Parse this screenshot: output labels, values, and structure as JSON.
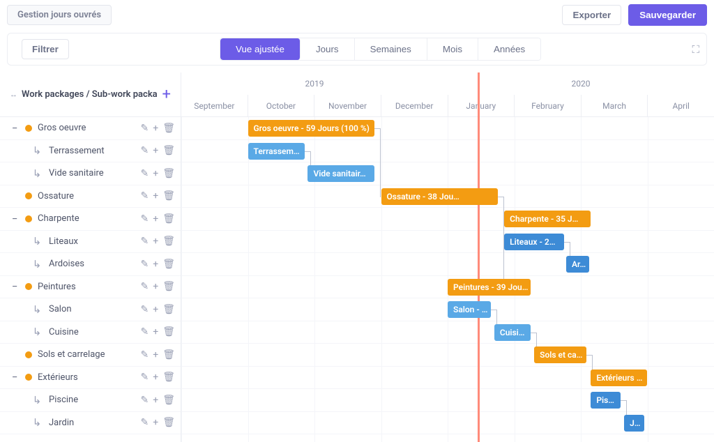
{
  "header": {
    "title": "Gestion jours ouvrés",
    "export_label": "Exporter",
    "save_label": "Sauvegarder"
  },
  "toolbar": {
    "filter_label": "Filtrer",
    "views": {
      "adjusted": "Vue ajustée",
      "days": "Jours",
      "weeks": "Semaines",
      "months": "Mois",
      "years": "Années"
    }
  },
  "sidebar": {
    "header": "Work packages / Sub-work packa"
  },
  "timeline": {
    "years": [
      "2019",
      "2020"
    ],
    "months": [
      "September",
      "October",
      "November",
      "December",
      "January",
      "February",
      "March",
      "April"
    ]
  },
  "tasks": [
    {
      "id": "gros",
      "level": 0,
      "label": "Gros oeuvre",
      "bar": "Gros oeuvre - 59 Jours (100 %)",
      "color": "orange"
    },
    {
      "id": "terr",
      "level": 1,
      "label": "Terrassement",
      "bar": "Terrassem…",
      "color": "blue"
    },
    {
      "id": "vide",
      "level": 1,
      "label": "Vide sanitaire",
      "bar": "Vide sanitair…",
      "color": "blue"
    },
    {
      "id": "ossa",
      "level": 0,
      "label": "Ossature",
      "bar": "Ossature - 38 Jou…",
      "color": "orange",
      "notoggle": true
    },
    {
      "id": "charp",
      "level": 0,
      "label": "Charpente",
      "bar": "Charpente - 35 J…",
      "color": "orange"
    },
    {
      "id": "lit",
      "level": 1,
      "label": "Liteaux",
      "bar": "Liteaux - 2…",
      "color": "blue2"
    },
    {
      "id": "ard",
      "level": 1,
      "label": "Ardoises",
      "bar": "Ar…",
      "color": "blue2"
    },
    {
      "id": "peint",
      "level": 0,
      "label": "Peintures",
      "bar": "Peintures - 39 Jou…",
      "color": "orange"
    },
    {
      "id": "salon",
      "level": 1,
      "label": "Salon",
      "bar": "Salon - …",
      "color": "blue"
    },
    {
      "id": "cuis",
      "level": 1,
      "label": "Cuisine",
      "bar": "Cuisi…",
      "color": "blue"
    },
    {
      "id": "sols",
      "level": 0,
      "label": "Sols et carrelage",
      "bar": "Sols et ca…",
      "color": "orange",
      "notoggle": true
    },
    {
      "id": "ext",
      "level": 0,
      "label": "Extérieurs",
      "bar": "Extérieurs …",
      "color": "orange"
    },
    {
      "id": "pisc",
      "level": 1,
      "label": "Piscine",
      "bar": "Pis…",
      "color": "blue2"
    },
    {
      "id": "jard",
      "level": 1,
      "label": "Jardin",
      "bar": "J…",
      "color": "blue2"
    }
  ],
  "chart_data": {
    "type": "gantt",
    "time_axis": {
      "start": "2019-09-01",
      "end": "2020-04-30",
      "today_marker": "2020-01-15"
    },
    "series": [
      {
        "name": "Gros oeuvre",
        "start": "2019-10-01",
        "end": "2019-11-28",
        "duration_days": 59,
        "progress": 1.0,
        "group": true
      },
      {
        "name": "Terrassement",
        "start": "2019-10-01",
        "end": "2019-10-25",
        "parent": "Gros oeuvre"
      },
      {
        "name": "Vide sanitaire",
        "start": "2019-10-28",
        "end": "2019-11-28",
        "parent": "Gros oeuvre"
      },
      {
        "name": "Ossature",
        "start": "2019-12-01",
        "end": "2020-01-24",
        "duration_days": 38
      },
      {
        "name": "Charpente",
        "start": "2020-01-27",
        "end": "2020-03-12",
        "duration_days": 35,
        "group": true
      },
      {
        "name": "Liteaux",
        "start": "2020-01-27",
        "end": "2020-02-24",
        "parent": "Charpente"
      },
      {
        "name": "Ardoises",
        "start": "2020-02-25",
        "end": "2020-03-12",
        "parent": "Charpente"
      },
      {
        "name": "Peintures",
        "start": "2020-01-01",
        "end": "2020-02-24",
        "duration_days": 39,
        "group": true
      },
      {
        "name": "Salon",
        "start": "2020-01-01",
        "end": "2020-01-20",
        "parent": "Peintures"
      },
      {
        "name": "Cuisine",
        "start": "2020-01-21",
        "end": "2020-02-07",
        "parent": "Peintures"
      },
      {
        "name": "Sols et carrelage",
        "start": "2020-02-10",
        "end": "2020-03-05"
      },
      {
        "name": "Extérieurs",
        "start": "2020-03-06",
        "end": "2020-04-05",
        "group": true
      },
      {
        "name": "Piscine",
        "start": "2020-03-06",
        "end": "2020-03-20",
        "parent": "Extérieurs"
      },
      {
        "name": "Jardin",
        "start": "2020-03-23",
        "end": "2020-04-05",
        "parent": "Extérieurs"
      }
    ],
    "dependencies": [
      [
        "Gros oeuvre",
        "Ossature"
      ],
      [
        "Terrassement",
        "Vide sanitaire"
      ],
      [
        "Ossature",
        "Charpente"
      ],
      [
        "Ossature",
        "Peintures"
      ],
      [
        "Liteaux",
        "Ardoises"
      ],
      [
        "Salon",
        "Cuisine"
      ],
      [
        "Cuisine",
        "Sols et carrelage"
      ],
      [
        "Sols et carrelage",
        "Extérieurs"
      ],
      [
        "Piscine",
        "Jardin"
      ]
    ]
  }
}
